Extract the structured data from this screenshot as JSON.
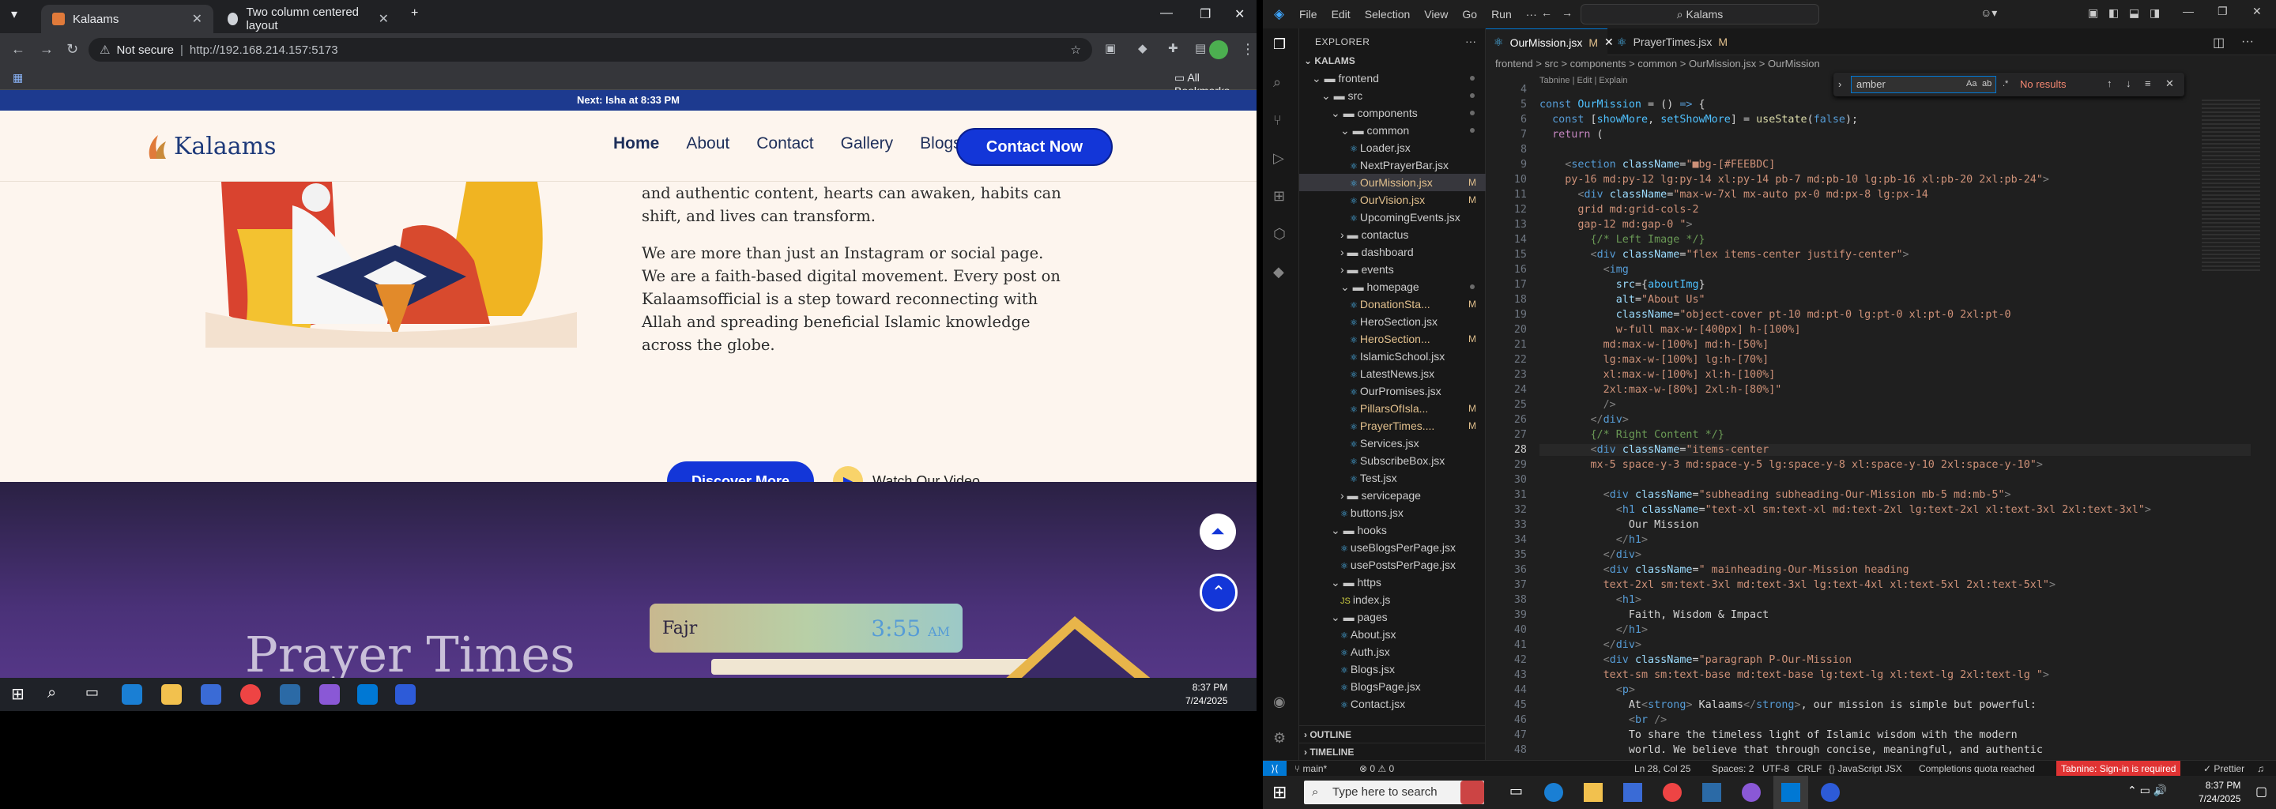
{
  "browser": {
    "tabs": [
      {
        "label": "Kalaams",
        "active": true
      },
      {
        "label": "Two column centered layout",
        "active": false
      }
    ],
    "url_prefix": "Not secure",
    "url": "http://192.168.214.157:5173",
    "bookmarks_label": "All Bookmarks"
  },
  "site": {
    "prayer_banner": "Next: Isha at 8:33 PM",
    "logo_text": "Kalaams",
    "nav": [
      "Home",
      "About",
      "Contact",
      "Gallery",
      "Blogs"
    ],
    "contact_button": "Contact Now",
    "para1": "and authentic content, hearts can awaken, habits can shift, and lives can transform.",
    "para2": "We are more than just an Instagram or social page. We are a faith-based digital movement. Every post on Kalaamsofficial is a step toward reconnecting with Allah and spreading beneficial Islamic knowledge across the globe.",
    "discover_button": "Discover More",
    "watch_video": "Watch Our Video",
    "prayer_section_title": "Prayer Times",
    "prayer": {
      "name": "Fajr",
      "time": "3:55",
      "ampm": "AM"
    }
  },
  "browser_taskbar": {
    "time": "8:37 PM",
    "date": "7/24/2025"
  },
  "vscode": {
    "menu": [
      "File",
      "Edit",
      "Selection",
      "View",
      "Go",
      "Run",
      "···"
    ],
    "command_center": "Kalams",
    "explorer_header": "EXPLORER",
    "root": "KALAMS",
    "tree": [
      {
        "depth": 1,
        "label": "frontend",
        "kind": "folder-open",
        "dot": true
      },
      {
        "depth": 2,
        "label": "src",
        "kind": "folder-open",
        "dot": true
      },
      {
        "depth": 3,
        "label": "components",
        "kind": "folder-open",
        "dot": true
      },
      {
        "depth": 4,
        "label": "common",
        "kind": "folder-open",
        "dot": true
      },
      {
        "depth": 5,
        "label": "Loader.jsx",
        "kind": "file"
      },
      {
        "depth": 5,
        "label": "NextPrayerBar.jsx",
        "kind": "file"
      },
      {
        "depth": 5,
        "label": "OurMission.jsx",
        "kind": "file",
        "mark": "M",
        "selected": true
      },
      {
        "depth": 5,
        "label": "OurVision.jsx",
        "kind": "file",
        "mark": "M"
      },
      {
        "depth": 5,
        "label": "UpcomingEvents.jsx",
        "kind": "file"
      },
      {
        "depth": 4,
        "label": "contactus",
        "kind": "folder"
      },
      {
        "depth": 4,
        "label": "dashboard",
        "kind": "folder"
      },
      {
        "depth": 4,
        "label": "events",
        "kind": "folder"
      },
      {
        "depth": 4,
        "label": "homepage",
        "kind": "folder-open",
        "dot": true
      },
      {
        "depth": 5,
        "label": "DonationSta...",
        "kind": "file",
        "mark": "M"
      },
      {
        "depth": 5,
        "label": "HeroSection.jsx",
        "kind": "file"
      },
      {
        "depth": 5,
        "label": "HeroSection...",
        "kind": "file",
        "mark": "M"
      },
      {
        "depth": 5,
        "label": "IslamicSchool.jsx",
        "kind": "file"
      },
      {
        "depth": 5,
        "label": "LatestNews.jsx",
        "kind": "file"
      },
      {
        "depth": 5,
        "label": "OurPromises.jsx",
        "kind": "file"
      },
      {
        "depth": 5,
        "label": "PillarsOfIsla...",
        "kind": "file",
        "mark": "M"
      },
      {
        "depth": 5,
        "label": "PrayerTimes....",
        "kind": "file",
        "mark": "M"
      },
      {
        "depth": 5,
        "label": "Services.jsx",
        "kind": "file"
      },
      {
        "depth": 5,
        "label": "SubscribeBox.jsx",
        "kind": "file"
      },
      {
        "depth": 5,
        "label": "Test.jsx",
        "kind": "file"
      },
      {
        "depth": 4,
        "label": "servicepage",
        "kind": "folder"
      },
      {
        "depth": 4,
        "label": "buttons.jsx",
        "kind": "file"
      },
      {
        "depth": 3,
        "label": "hooks",
        "kind": "folder-open"
      },
      {
        "depth": 4,
        "label": "useBlogsPerPage.jsx",
        "kind": "file"
      },
      {
        "depth": 4,
        "label": "usePostsPerPage.jsx",
        "kind": "file"
      },
      {
        "depth": 3,
        "label": "https",
        "kind": "folder-open"
      },
      {
        "depth": 4,
        "label": "index.js",
        "kind": "file"
      },
      {
        "depth": 3,
        "label": "pages",
        "kind": "folder-open"
      },
      {
        "depth": 4,
        "label": "About.jsx",
        "kind": "file"
      },
      {
        "depth": 4,
        "label": "Auth.jsx",
        "kind": "file"
      },
      {
        "depth": 4,
        "label": "Blogs.jsx",
        "kind": "file"
      },
      {
        "depth": 4,
        "label": "BlogsPage.jsx",
        "kind": "file"
      },
      {
        "depth": 4,
        "label": "Contact.jsx",
        "kind": "file"
      }
    ],
    "outline": "OUTLINE",
    "timeline": "TIMELINE",
    "tabs": [
      {
        "label": "OurMission.jsx",
        "mark": "M",
        "active": true
      },
      {
        "label": "PrayerTimes.jsx",
        "mark": "M",
        "active": false
      }
    ],
    "breadcrumbs": "frontend > src > components > common > OurMission.jsx > OurMission",
    "find": {
      "query": "amber",
      "result": "No results"
    },
    "codelens": "Tabnine | Edit | Explain",
    "code_lines": [
      {
        "n": "4",
        "html": ""
      },
      {
        "n": "5",
        "html": "<span class='k'>const</span> <span class='v'>OurMission</span> = () <span class='k'>=&gt;</span> {"
      },
      {
        "n": "6",
        "html": "  <span class='k'>const</span> [<span class='v'>showMore</span>, <span class='v'>setShowMore</span>] = <span class='f'>useState</span>(<span class='k'>false</span>);"
      },
      {
        "n": "7",
        "html": "  <span class='k2'>return</span> ("
      },
      {
        "n": "8",
        "html": ""
      },
      {
        "n": "9",
        "html": "    <span class='p'>&lt;</span><span class='t'>section</span> <span class='a'>className</span>=<span class='s'>\"■bg-[#FEEBDC]</span>"
      },
      {
        "n": "10",
        "html": "<span class='s'>    py-16 md:py-12 lg:py-14 xl:py-14 pb-7 md:pb-10 lg:pb-16 xl:pb-20 2xl:pb-24\"</span><span class='p'>&gt;</span>"
      },
      {
        "n": "11",
        "html": "      <span class='p'>&lt;</span><span class='t'>div</span> <span class='a'>className</span>=<span class='s'>\"max-w-7xl mx-auto px-0 md:px-8 lg:px-14</span>"
      },
      {
        "n": "12",
        "html": "<span class='s'>      grid md:grid-cols-2</span>"
      },
      {
        "n": "13",
        "html": "<span class='s'>      gap-12 md:gap-0 \"</span><span class='p'>&gt;</span>"
      },
      {
        "n": "14",
        "html": "        <span class='c'>{/* Left Image */}</span>"
      },
      {
        "n": "15",
        "html": "        <span class='p'>&lt;</span><span class='t'>div</span> <span class='a'>className</span>=<span class='s'>\"flex items-center justify-center\"</span><span class='p'>&gt;</span>"
      },
      {
        "n": "16",
        "html": "          <span class='p'>&lt;</span><span class='t'>img</span>"
      },
      {
        "n": "17",
        "html": "            <span class='a'>src</span>={<span class='v'>aboutImg</span>}"
      },
      {
        "n": "18",
        "html": "            <span class='a'>alt</span>=<span class='s'>\"About Us\"</span>"
      },
      {
        "n": "19",
        "html": "            <span class='a'>className</span>=<span class='s'>\"object-cover pt-10 md:pt-0 lg:pt-0 xl:pt-0 2xl:pt-0</span>"
      },
      {
        "n": "20",
        "html": "<span class='s'>            w-full max-w-[400px] h-[100%]</span>"
      },
      {
        "n": "21",
        "html": "<span class='s'>          md:max-w-[100%] md:h-[50%]</span>"
      },
      {
        "n": "22",
        "html": "<span class='s'>          lg:max-w-[100%] lg:h-[70%]</span>"
      },
      {
        "n": "23",
        "html": "<span class='s'>          xl:max-w-[100%] xl:h-[100%]</span>"
      },
      {
        "n": "24",
        "html": "<span class='s'>          2xl:max-w-[80%] 2xl:h-[80%]\"</span>"
      },
      {
        "n": "25",
        "html": "          <span class='p'>/&gt;</span>"
      },
      {
        "n": "26",
        "html": "        <span class='p'>&lt;/</span><span class='t'>div</span><span class='p'>&gt;</span>"
      },
      {
        "n": "27",
        "html": "        <span class='c'>{/* Right Content */}</span>"
      },
      {
        "n": "28",
        "html": "        <span class='p'>&lt;</span><span class='t'>div</span> <span class='a'>className</span>=<span class='s'>\"items-center</span>"
      },
      {
        "n": "29",
        "html": "<span class='s'>        mx-5 space-y-3 md:space-y-5 lg:space-y-8 xl:space-y-10 2xl:space-y-10\"</span><span class='p'>&gt;</span>"
      },
      {
        "n": "30",
        "html": ""
      },
      {
        "n": "31",
        "html": "          <span class='p'>&lt;</span><span class='t'>div</span> <span class='a'>className</span>=<span class='s'>\"subheading subheading-Our-Mission mb-5 md:mb-5\"</span><span class='p'>&gt;</span>"
      },
      {
        "n": "32",
        "html": "            <span class='p'>&lt;</span><span class='t'>h1</span> <span class='a'>className</span>=<span class='s'>\"text-xl sm:text-xl md:text-2xl lg:text-2xl xl:text-3xl 2xl:text-3xl\"</span><span class='p'>&gt;</span>"
      },
      {
        "n": "33",
        "html": "              Our Mission"
      },
      {
        "n": "34",
        "html": "            <span class='p'>&lt;/</span><span class='t'>h1</span><span class='p'>&gt;</span>"
      },
      {
        "n": "35",
        "html": "          <span class='p'>&lt;/</span><span class='t'>div</span><span class='p'>&gt;</span>"
      },
      {
        "n": "36",
        "html": "          <span class='p'>&lt;</span><span class='t'>div</span> <span class='a'>className</span>=<span class='s'>\" mainheading-Our-Mission heading</span>"
      },
      {
        "n": "37",
        "html": "<span class='s'>          text-2xl sm:text-3xl md:text-3xl lg:text-4xl xl:text-5xl 2xl:text-5xl\"</span><span class='p'>&gt;</span>"
      },
      {
        "n": "38",
        "html": "            <span class='p'>&lt;</span><span class='t'>h1</span><span class='p'>&gt;</span>"
      },
      {
        "n": "39",
        "html": "              Faith, Wisdom &amp; Impact"
      },
      {
        "n": "40",
        "html": "            <span class='p'>&lt;/</span><span class='t'>h1</span><span class='p'>&gt;</span>"
      },
      {
        "n": "41",
        "html": "          <span class='p'>&lt;/</span><span class='t'>div</span><span class='p'>&gt;</span>"
      },
      {
        "n": "42",
        "html": "          <span class='p'>&lt;</span><span class='t'>div</span> <span class='a'>className</span>=<span class='s'>\"paragraph P-Our-Mission</span>"
      },
      {
        "n": "43",
        "html": "<span class='s'>          text-sm sm:text-base md:text-base lg:text-lg xl:text-lg 2xl:text-lg \"</span><span class='p'>&gt;</span>"
      },
      {
        "n": "44",
        "html": "            <span class='p'>&lt;</span><span class='t'>p</span><span class='p'>&gt;</span>"
      },
      {
        "n": "45",
        "html": "              At<span class='p'>&lt;</span><span class='t'>strong</span><span class='p'>&gt;</span> Kalaams<span class='p'>&lt;/</span><span class='t'>strong</span><span class='p'>&gt;</span>, our mission is simple but powerful:"
      },
      {
        "n": "46",
        "html": "              <span class='p'>&lt;</span><span class='t'>br</span> <span class='p'>/&gt;</span>"
      },
      {
        "n": "47",
        "html": "              To share the timeless light of Islamic wisdom with the modern"
      },
      {
        "n": "48",
        "html": "              world. We believe that through concise, meaningful, and authentic"
      }
    ],
    "status": {
      "branch": "main*",
      "errors": "⊗ 0 ⚠ 0",
      "position": "Ln 28, Col 25",
      "spaces": "Spaces: 2",
      "encoding": "UTF-8",
      "eol": "CRLF",
      "language": "{} JavaScript JSX",
      "quota": "Completions quota reached",
      "tabnine": "Tabnine: Sign-in is required",
      "prettier": "✓ Prettier"
    }
  },
  "taskbar": {
    "search_placeholder": "Type here to search",
    "time": "8:37 PM",
    "date": "7/24/2025"
  }
}
